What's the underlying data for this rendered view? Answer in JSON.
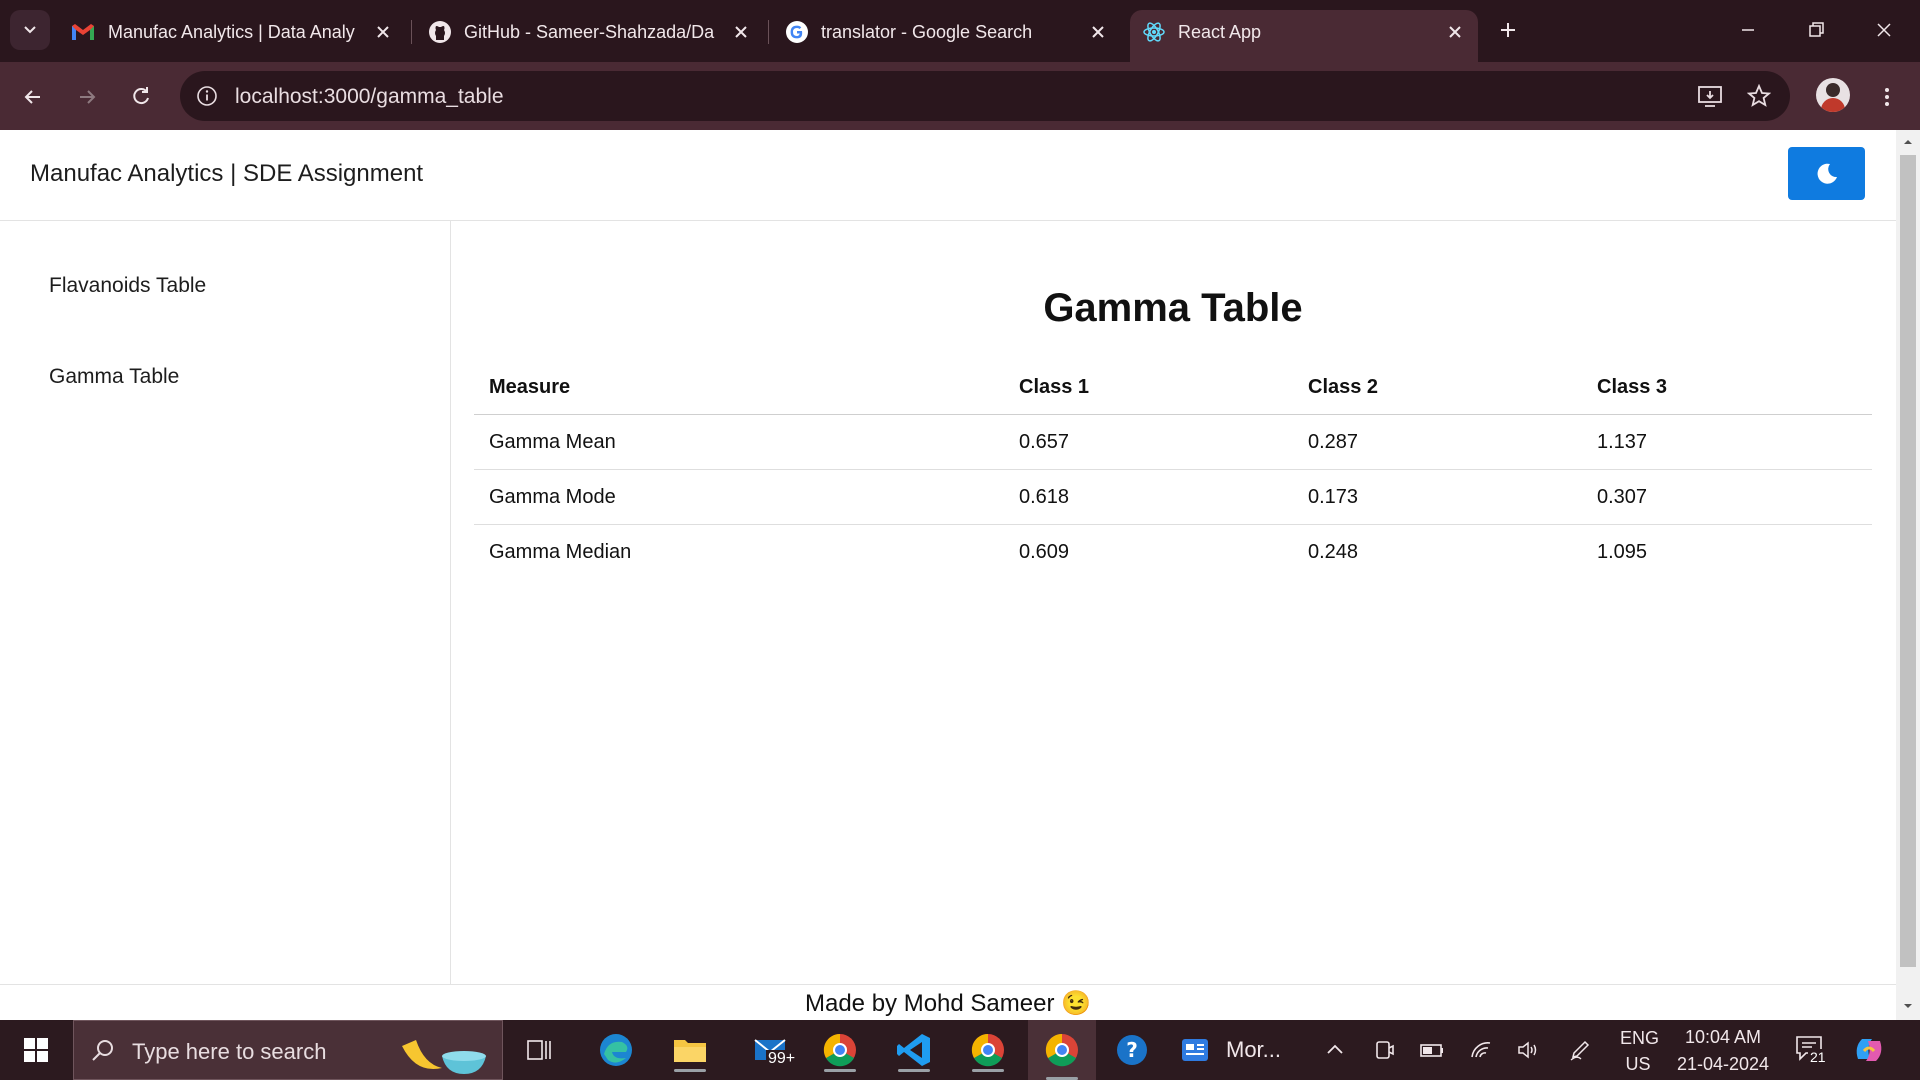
{
  "browser": {
    "tabs": [
      {
        "title": "Manufac Analytics | Data Analy",
        "icon": "gmail-icon"
      },
      {
        "title": "GitHub - Sameer-Shahzada/Da",
        "icon": "github-icon"
      },
      {
        "title": "translator - Google Search",
        "icon": "google-icon"
      },
      {
        "title": "React App",
        "icon": "react-icon",
        "active": true
      }
    ],
    "url": "localhost:3000/gamma_table"
  },
  "app": {
    "brand": "Manufac Analytics | SDE Assignment",
    "theme_toggle_icon": "moon-icon",
    "accent_color": "#0f7be0",
    "sidebar": [
      "Flavanoids Table",
      "Gamma Table"
    ],
    "title": "Gamma Table",
    "table": {
      "headers": [
        "Measure",
        "Class 1",
        "Class 2",
        "Class 3"
      ],
      "rows": [
        [
          "Gamma Mean",
          "0.657",
          "0.287",
          "1.137"
        ],
        [
          "Gamma Mode",
          "0.618",
          "0.173",
          "0.307"
        ],
        [
          "Gamma Median",
          "0.609",
          "0.248",
          "1.095"
        ]
      ]
    },
    "footer": "Made by Mohd Sameer 😉"
  },
  "taskbar": {
    "search_placeholder": "Type here to search",
    "mail_badge": "99+",
    "window_label": "Mor...",
    "lang_top": "ENG",
    "lang_bottom": "US",
    "time": "10:04 AM",
    "date": "21-04-2024",
    "notifications": "21"
  }
}
